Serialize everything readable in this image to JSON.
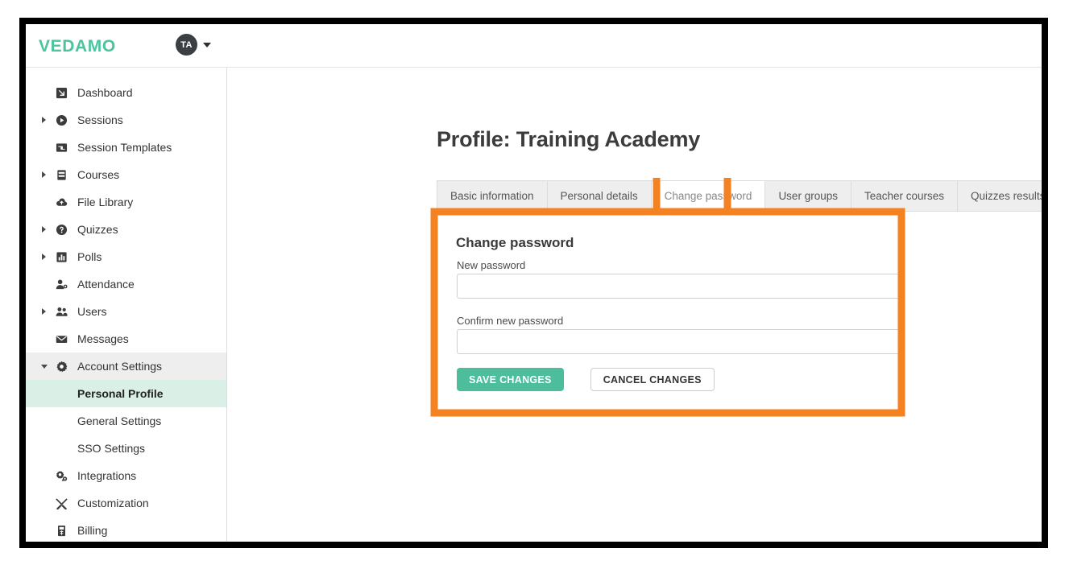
{
  "header": {
    "logo": "VEDAMO",
    "avatar_initials": "TA",
    "caret_icon": "chevron-down-icon"
  },
  "colors": {
    "brand_green": "#4dc39e",
    "highlight_orange": "#F58220",
    "save_button": "#4dbd9c",
    "selected_nav_bg": "#daf0e6",
    "parent_nav_bg": "#eeeeee"
  },
  "sidebar": {
    "items": [
      {
        "label": "Dashboard",
        "icon": "dashboard-arrow-icon",
        "expandable": false,
        "level": 0
      },
      {
        "label": "Sessions",
        "icon": "play-circle-icon",
        "expandable": true,
        "level": 0
      },
      {
        "label": "Session Templates",
        "icon": "template-icon",
        "expandable": false,
        "level": 0
      },
      {
        "label": "Courses",
        "icon": "book-icon",
        "expandable": true,
        "level": 0
      },
      {
        "label": "File Library",
        "icon": "cloud-icon",
        "expandable": false,
        "level": 0
      },
      {
        "label": "Quizzes",
        "icon": "question-circle-icon",
        "expandable": true,
        "level": 0
      },
      {
        "label": "Polls",
        "icon": "bar-chart-icon",
        "expandable": true,
        "level": 0
      },
      {
        "label": "Attendance",
        "icon": "user-check-icon",
        "expandable": false,
        "level": 0
      },
      {
        "label": "Users",
        "icon": "users-icon",
        "expandable": true,
        "level": 0
      },
      {
        "label": "Messages",
        "icon": "envelope-icon",
        "expandable": false,
        "level": 0
      },
      {
        "label": "Account Settings",
        "icon": "gear-icon",
        "expandable": true,
        "level": 0,
        "expanded": true,
        "state": "active-parent"
      },
      {
        "label": "Personal Profile",
        "icon": null,
        "expandable": false,
        "level": 1,
        "state": "selected"
      },
      {
        "label": "General Settings",
        "icon": null,
        "expandable": false,
        "level": 1
      },
      {
        "label": "SSO Settings",
        "icon": null,
        "expandable": false,
        "level": 1
      },
      {
        "label": "Integrations",
        "icon": "gears-icon",
        "expandable": false,
        "level": 0
      },
      {
        "label": "Customization",
        "icon": "tools-icon",
        "expandable": false,
        "level": 0
      },
      {
        "label": "Billing",
        "icon": "invoice-icon",
        "expandable": false,
        "level": 0
      }
    ]
  },
  "main": {
    "page_title": "Profile: Training Academy",
    "tabs": [
      {
        "label": "Basic information",
        "active": false
      },
      {
        "label": "Personal details",
        "active": false
      },
      {
        "label": "Change password",
        "active": true
      },
      {
        "label": "User groups",
        "active": false
      },
      {
        "label": "Teacher courses",
        "active": false
      },
      {
        "label": "Quizzes results",
        "active": false
      }
    ],
    "panel": {
      "title": "Change password",
      "fields": [
        {
          "label": "New password",
          "value": "",
          "placeholder": ""
        },
        {
          "label": "Confirm new password",
          "value": "",
          "placeholder": ""
        }
      ],
      "buttons": {
        "save": "SAVE CHANGES",
        "cancel": "CANCEL CHANGES"
      }
    }
  }
}
